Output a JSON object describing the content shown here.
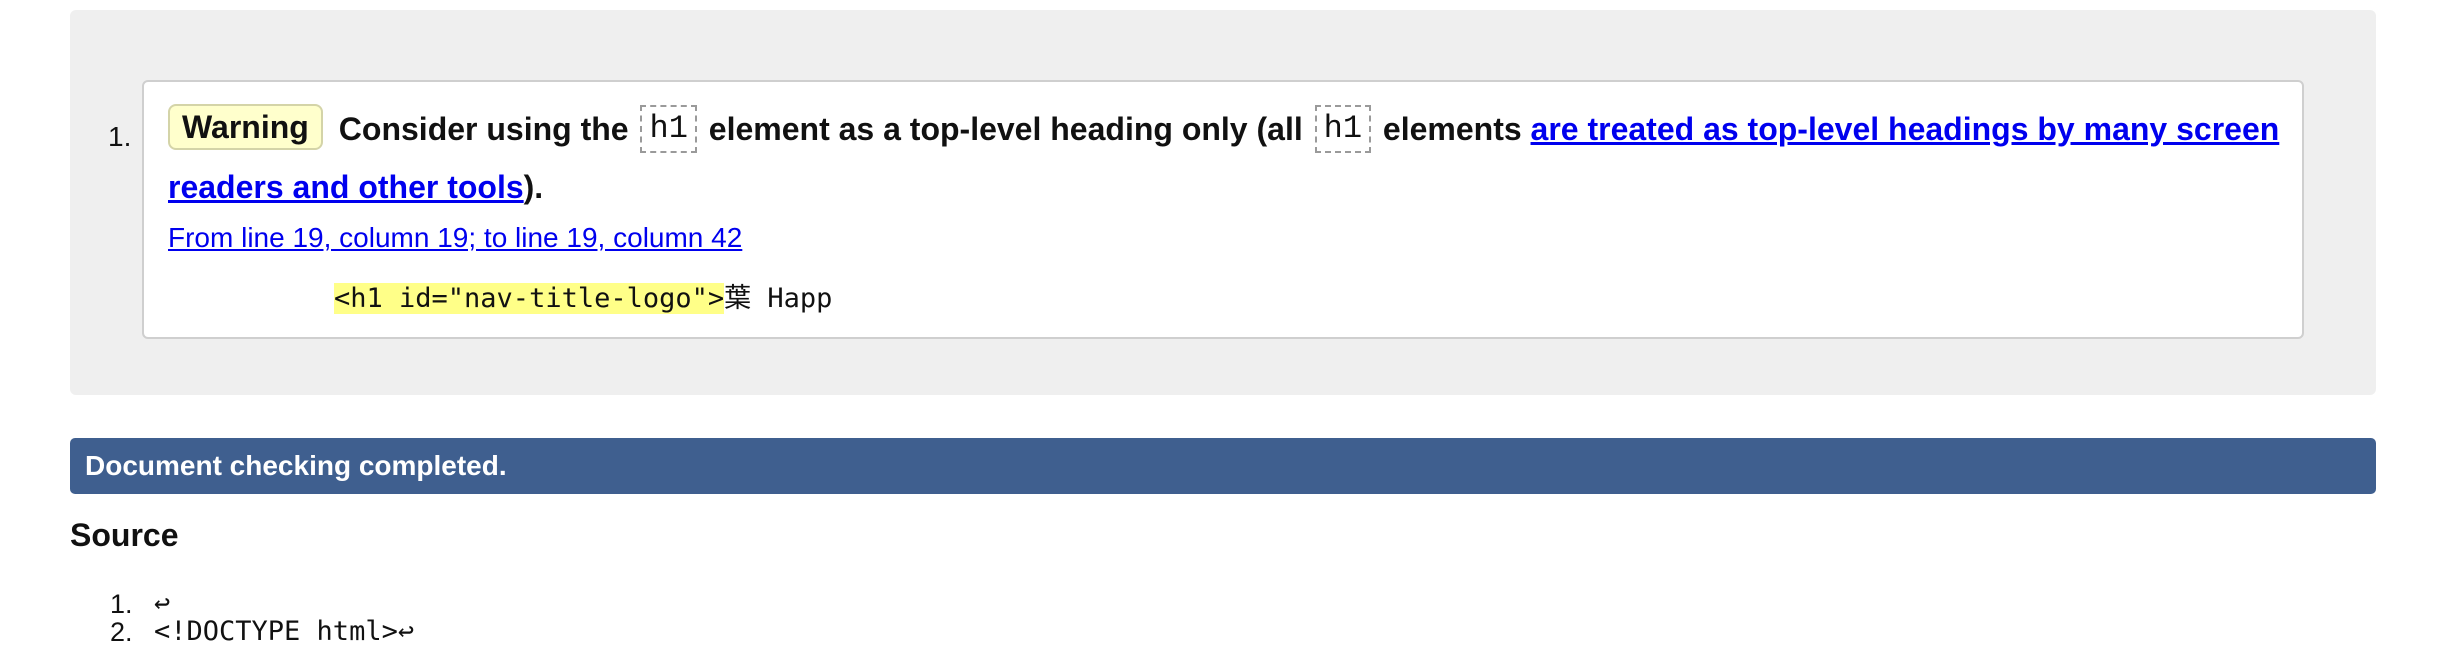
{
  "message": {
    "number": "1.",
    "severity": "Warning",
    "text_before_h1": "Consider using the",
    "h1_tag_1": "h1",
    "text_between_tags": "element as a top-level heading only (all",
    "h1_tag_2": "h1",
    "text_after_tag": "elements",
    "link_text": "are treated as top-level headings by many screen readers and other tools",
    "end_text": ").",
    "location": "From line 19, column 19; to line 19, column 42",
    "extract_highlight": "<h1 id=\"nav-title-logo\">",
    "extract_after": "葉 Happ"
  },
  "status": {
    "text": "Document checking completed."
  },
  "source": {
    "heading": "Source",
    "lines": [
      {
        "number": "1.",
        "code": "↩"
      },
      {
        "number": "2.",
        "code": "<!DOCTYPE html>↩"
      }
    ]
  },
  "colors": {
    "warning_background": "#ffffcc",
    "status_bar": "#3f5f8f",
    "link": "#0000ee",
    "highlight": "#ffff88"
  },
  "icons": {
    "line_break": "return-symbol-icon"
  }
}
